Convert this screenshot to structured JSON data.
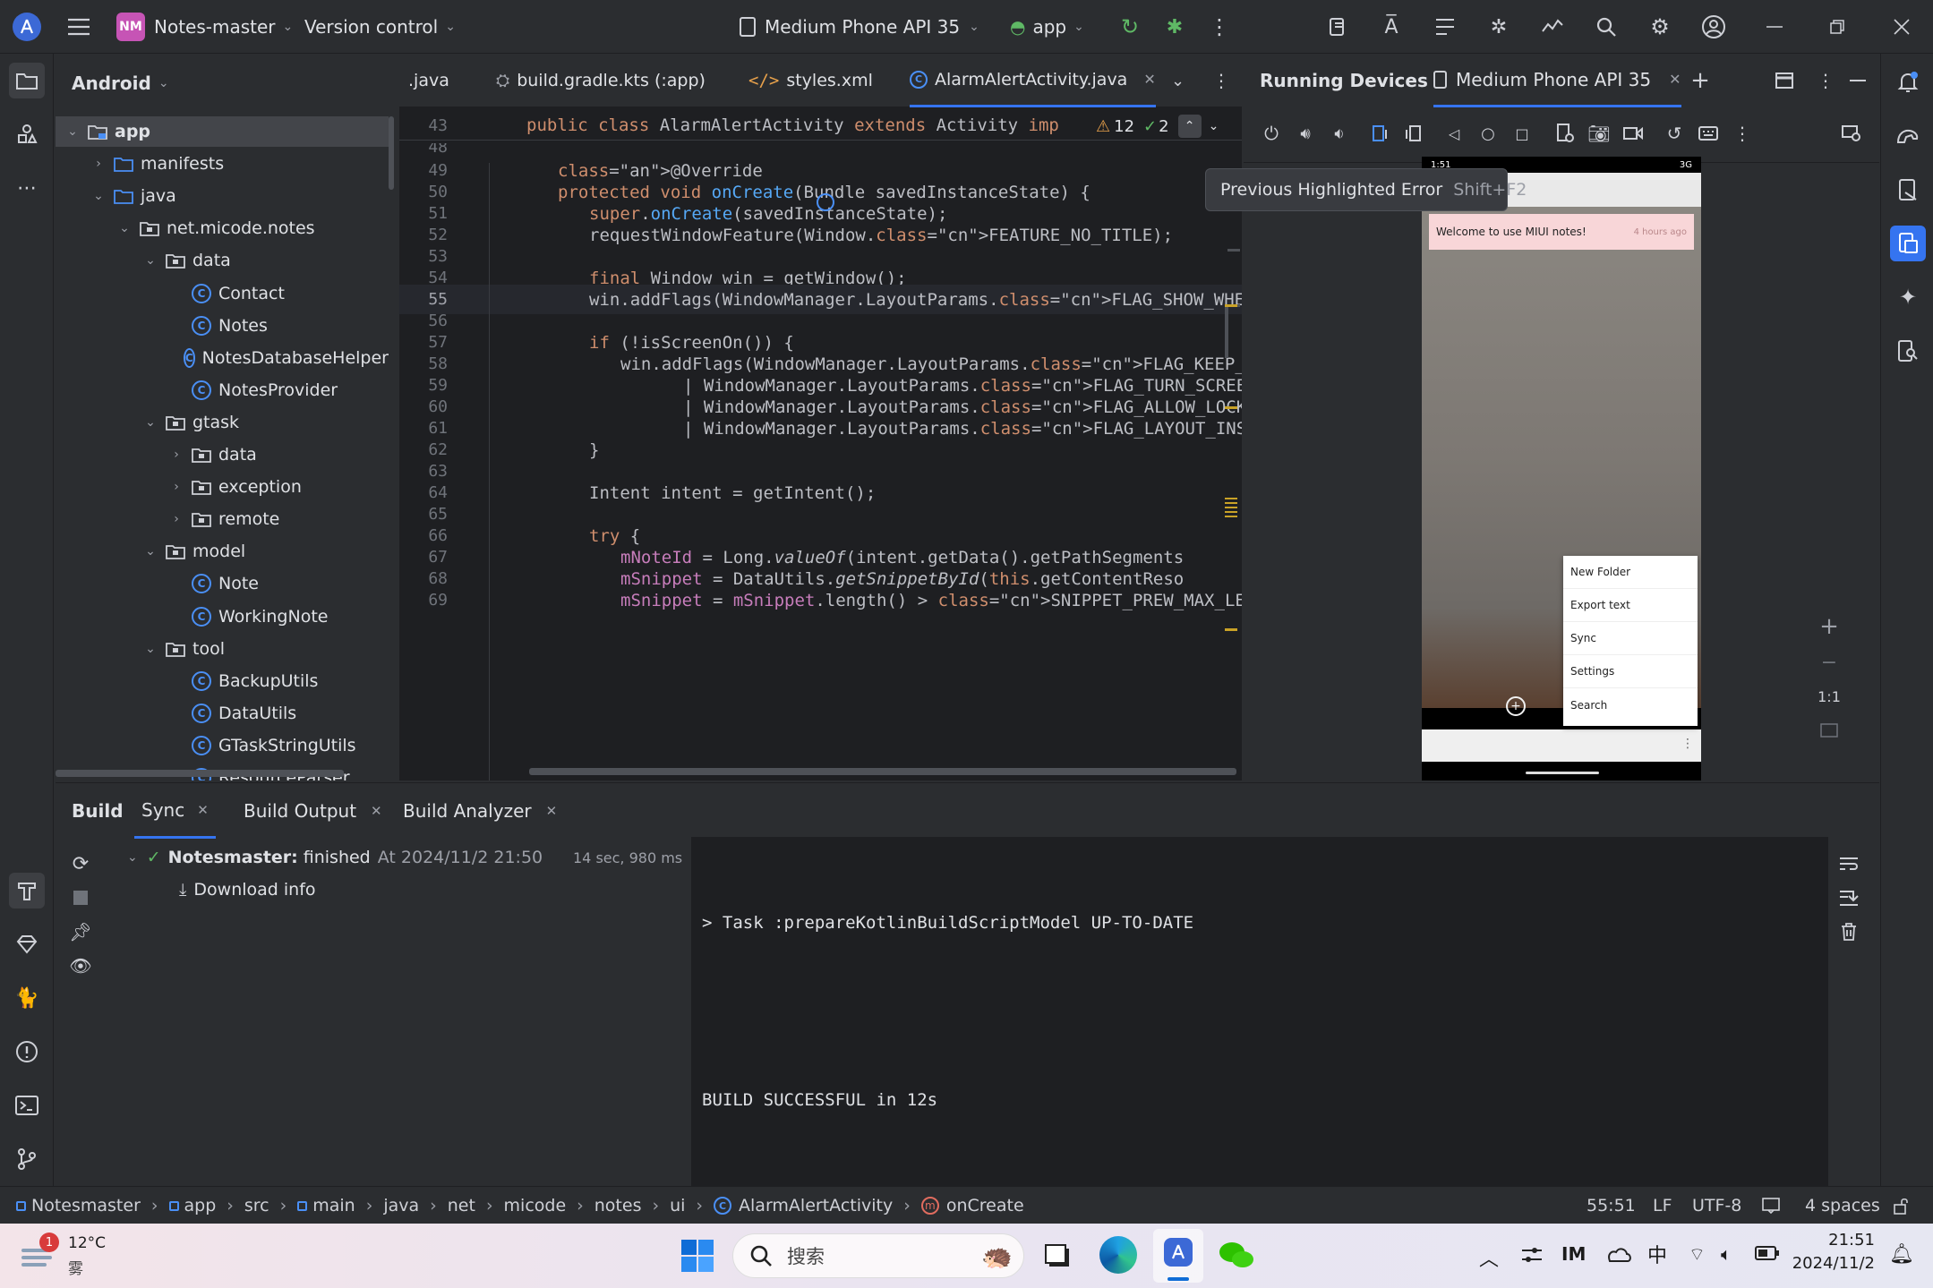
{
  "topbar": {
    "project_badge": "NM",
    "project_name": "Notes-master",
    "vcs": "Version control",
    "device": "Medium Phone API 35",
    "run_config": "app"
  },
  "project": {
    "view": "Android",
    "tree": [
      {
        "label": "app",
        "depth": 0,
        "kind": "folder-mod",
        "open": true,
        "selected": true
      },
      {
        "label": "manifests",
        "depth": 1,
        "kind": "folder",
        "open": false
      },
      {
        "label": "java",
        "depth": 1,
        "kind": "folder",
        "open": true
      },
      {
        "label": "net.micode.notes",
        "depth": 2,
        "kind": "pkg",
        "open": true
      },
      {
        "label": "data",
        "depth": 3,
        "kind": "pkg",
        "open": true
      },
      {
        "label": "Contact",
        "depth": 4,
        "kind": "class"
      },
      {
        "label": "Notes",
        "depth": 4,
        "kind": "class"
      },
      {
        "label": "NotesDatabaseHelper",
        "depth": 4,
        "kind": "class"
      },
      {
        "label": "NotesProvider",
        "depth": 4,
        "kind": "class"
      },
      {
        "label": "gtask",
        "depth": 3,
        "kind": "pkg",
        "open": true
      },
      {
        "label": "data",
        "depth": 4,
        "kind": "pkg",
        "open": false
      },
      {
        "label": "exception",
        "depth": 4,
        "kind": "pkg",
        "open": false
      },
      {
        "label": "remote",
        "depth": 4,
        "kind": "pkg",
        "open": false
      },
      {
        "label": "model",
        "depth": 3,
        "kind": "pkg",
        "open": true
      },
      {
        "label": "Note",
        "depth": 4,
        "kind": "class"
      },
      {
        "label": "WorkingNote",
        "depth": 4,
        "kind": "class"
      },
      {
        "label": "tool",
        "depth": 3,
        "kind": "pkg",
        "open": true
      },
      {
        "label": "BackupUtils",
        "depth": 4,
        "kind": "class"
      },
      {
        "label": "DataUtils",
        "depth": 4,
        "kind": "class"
      },
      {
        "label": "GTaskStringUtils",
        "depth": 4,
        "kind": "class"
      },
      {
        "label": "ResourceParser",
        "depth": 4,
        "kind": "class"
      }
    ]
  },
  "editor": {
    "tabs": [
      {
        "label": ".java"
      },
      {
        "label": "build.gradle.kts (:app)"
      },
      {
        "label": "styles.xml"
      },
      {
        "label": "AlarmAlertActivity.java",
        "active": true
      }
    ],
    "warnings": "12",
    "weak_warnings": "2",
    "sticky_line": "43",
    "sticky_text": "public class AlarmAlertActivity extends Activity imp",
    "lines": [
      {
        "n": "48",
        "t": ""
      },
      {
        "n": "49",
        "t": "@Override"
      },
      {
        "n": "50",
        "t": "protected void onCreate(Bundle savedInstanceState) {"
      },
      {
        "n": "51",
        "t": "super.onCreate(savedInstanceState);"
      },
      {
        "n": "52",
        "t": "requestWindowFeature(Window.FEATURE_NO_TITLE);"
      },
      {
        "n": "53",
        "t": ""
      },
      {
        "n": "54",
        "t": "final Window win = getWindow();"
      },
      {
        "n": "55",
        "t": "win.addFlags(WindowManager.LayoutParams.FLAG_SHOW_WHEN_LOCK"
      },
      {
        "n": "56",
        "t": ""
      },
      {
        "n": "57",
        "t": "if (!isScreenOn()) {"
      },
      {
        "n": "58",
        "t": "win.addFlags(WindowManager.LayoutParams.FLAG_KEEP_SCREE"
      },
      {
        "n": "59",
        "t": "| WindowManager.LayoutParams.FLAG_TURN_SCREEN_("
      },
      {
        "n": "60",
        "t": "| WindowManager.LayoutParams.FLAG_ALLOW_LOCK_WH"
      },
      {
        "n": "61",
        "t": "| WindowManager.LayoutParams.FLAG_LAYOUT_INSE"
      },
      {
        "n": "62",
        "t": "}"
      },
      {
        "n": "63",
        "t": ""
      },
      {
        "n": "64",
        "t": "Intent intent = getIntent();"
      },
      {
        "n": "65",
        "t": ""
      },
      {
        "n": "66",
        "t": "try {"
      },
      {
        "n": "67",
        "t": "mNoteId = Long.valueOf(intent.getData().getPathSegments"
      },
      {
        "n": "68",
        "t": "mSnippet = DataUtils.getSnippetById(this.getContentReso"
      },
      {
        "n": "69",
        "t": "mSnippet = mSnippet.length() > SNIPPET_PREW_MAX_LEN ? m"
      }
    ]
  },
  "tooltip": {
    "text": "Previous Highlighted Error",
    "shortcut": "Shift+F2"
  },
  "devices": {
    "title": "Running Devices",
    "tab": "Medium Phone API 35",
    "zoom_label": "1:1",
    "phone": {
      "clock": "1:51",
      "signal": "3G",
      "note_title": "Welcome to use MIUI notes!",
      "note_time": "4 hours ago",
      "menu": [
        "New Folder",
        "Export text",
        "Sync",
        "Settings",
        "Search"
      ]
    }
  },
  "build": {
    "tabs": [
      "Build",
      "Sync",
      "Build Output",
      "Build Analyzer"
    ],
    "tree_title": "Notesmaster:",
    "tree_status": "finished",
    "tree_time": "At 2024/11/2 21:50",
    "tree_duration": "14 sec, 980 ms",
    "download_info": "Download info",
    "console": [
      "> Task :prepareKotlinBuildScriptModel UP-TO-DATE",
      "",
      "BUILD SUCCESSFUL in 12s"
    ]
  },
  "status": {
    "crumbs": [
      "Notesmaster",
      "app",
      "src",
      "main",
      "java",
      "net",
      "micode",
      "notes",
      "ui",
      "AlarmAlertActivity",
      "onCreate"
    ],
    "position": "55:51",
    "line_sep": "LF",
    "encoding": "UTF-8",
    "indent": "4 spaces"
  },
  "taskbar": {
    "weather_badge": "1",
    "temp": "12°C",
    "weather": "雾",
    "search": "搜索",
    "ime": "中",
    "time": "21:51",
    "date": "2024/11/2"
  },
  "colors": {
    "accent": "#3574f0",
    "keyword": "#cf8e6d",
    "function": "#56a8f5",
    "constant": "#c77dbb",
    "annotation": "#b3ae60",
    "success": "#5fb865"
  }
}
